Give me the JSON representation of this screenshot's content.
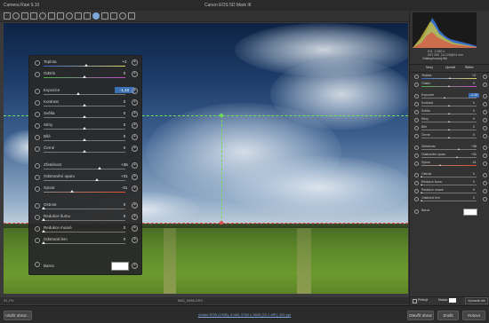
{
  "window": {
    "title": "Camera Raw 9.10",
    "camera": "Canon EOS 5D Mark III"
  },
  "toolbar": {
    "icons": [
      "zoom-icon",
      "hand-icon",
      "white-balance-icon",
      "color-sampler-icon",
      "targeted-adjustment-icon",
      "crop-icon",
      "straighten-icon",
      "spot-removal-icon",
      "red-eye-icon",
      "adjustment-brush-icon",
      "graduated-filter-icon",
      "radial-filter-icon",
      "preferences-icon",
      "rotate-left-icon",
      "rotate-right-icon"
    ]
  },
  "canvas": {
    "filename": "IMG_9456.CR2",
    "zoom": "31,7%"
  },
  "panel": {
    "rows": [
      {
        "label": "Teplota",
        "value": "+2",
        "slider": "temp",
        "knob": 0.52
      },
      {
        "label": "Odstín",
        "value": "0",
        "slider": "tint",
        "knob": 0.5
      },
      {
        "label": "Expozice",
        "value": "-1,10",
        "slider": "plain",
        "knob": 0.42,
        "highlight": true
      },
      {
        "label": "Kontrast",
        "value": "0",
        "slider": "plain",
        "knob": 0.5
      },
      {
        "label": "Světla",
        "value": "0",
        "slider": "plain",
        "knob": 0.5
      },
      {
        "label": "Stíny",
        "value": "0",
        "slider": "plain",
        "knob": 0.5
      },
      {
        "label": "Bílé",
        "value": "0",
        "slider": "plain",
        "knob": 0.5
      },
      {
        "label": "Černé",
        "value": "0",
        "slider": "plain",
        "knob": 0.5
      },
      {
        "label": "Zřetelnost",
        "value": "+36",
        "slider": "plain",
        "knob": 0.68
      },
      {
        "label": "Odstranění oparu",
        "value": "+31",
        "slider": "plain",
        "knob": 0.65
      },
      {
        "label": "Sytost",
        "value": "-31",
        "slider": "sat",
        "knob": 0.35
      },
      {
        "label": "Ostrost",
        "value": "0",
        "slider": "plain",
        "knob": 0.0
      },
      {
        "label": "Redukce šumu",
        "value": "0",
        "slider": "plain",
        "knob": 0.0
      },
      {
        "label": "Redukce moaré",
        "value": "0",
        "slider": "plain",
        "knob": 0.0
      },
      {
        "label": "Odstranit lem",
        "value": "0",
        "slider": "plain",
        "knob": 0.0
      }
    ],
    "color_label": "Barva"
  },
  "right_panel": {
    "header": "Odstupňovaný filtr",
    "mode_new": "Nový",
    "mode_edit": "Upravit",
    "mode_brush": "Štětec",
    "rows": [
      {
        "label": "Teplota",
        "value": "+2",
        "slider": "temp",
        "knob": 0.52
      },
      {
        "label": "Odstín",
        "value": "0",
        "slider": "tint",
        "knob": 0.5
      },
      {
        "label": "Expozice",
        "value": "-1,10",
        "slider": "plain",
        "knob": 0.42,
        "highlight": true
      },
      {
        "label": "Kontrast",
        "value": "0",
        "slider": "plain",
        "knob": 0.5
      },
      {
        "label": "Světla",
        "value": "0",
        "slider": "plain",
        "knob": 0.5
      },
      {
        "label": "Stíny",
        "value": "0",
        "slider": "plain",
        "knob": 0.5
      },
      {
        "label": "Bílé",
        "value": "0",
        "slider": "plain",
        "knob": 0.5
      },
      {
        "label": "Černé",
        "value": "0",
        "slider": "plain",
        "knob": 0.5
      },
      {
        "label": "Zřetelnost",
        "value": "+36",
        "slider": "plain",
        "knob": 0.68
      },
      {
        "label": "Odstranění oparu",
        "value": "+31",
        "slider": "plain",
        "knob": 0.65
      },
      {
        "label": "Sytost",
        "value": "-31",
        "slider": "sat",
        "knob": 0.35
      },
      {
        "label": "Ostrost",
        "value": "0",
        "slider": "plain",
        "knob": 0.0
      },
      {
        "label": "Redukce šumu",
        "value": "0",
        "slider": "plain",
        "knob": 0.0
      },
      {
        "label": "Redukce moaré",
        "value": "0",
        "slider": "plain",
        "knob": 0.0
      },
      {
        "label": "Odstranit lem",
        "value": "0",
        "slider": "plain",
        "knob": 0.0
      }
    ],
    "color_label": "Barva",
    "mask_label": "Překrýt",
    "mask2_label": "Maska",
    "clear_label": "Vymazat vše",
    "histogram_info": [
      "f/11",
      "1/160 s",
      "ISO 200",
      "24-105@24 mm"
    ]
  },
  "footer": {
    "save_label": "Uložit obraz...",
    "info_link": "Adobe RGB (1998); 8 bitů; 5760 x 3840 (22,1 MP); 300 ppi",
    "open_label": "Otevřít obraz",
    "cancel_label": "Zrušit",
    "done_label": "Hotovo"
  }
}
